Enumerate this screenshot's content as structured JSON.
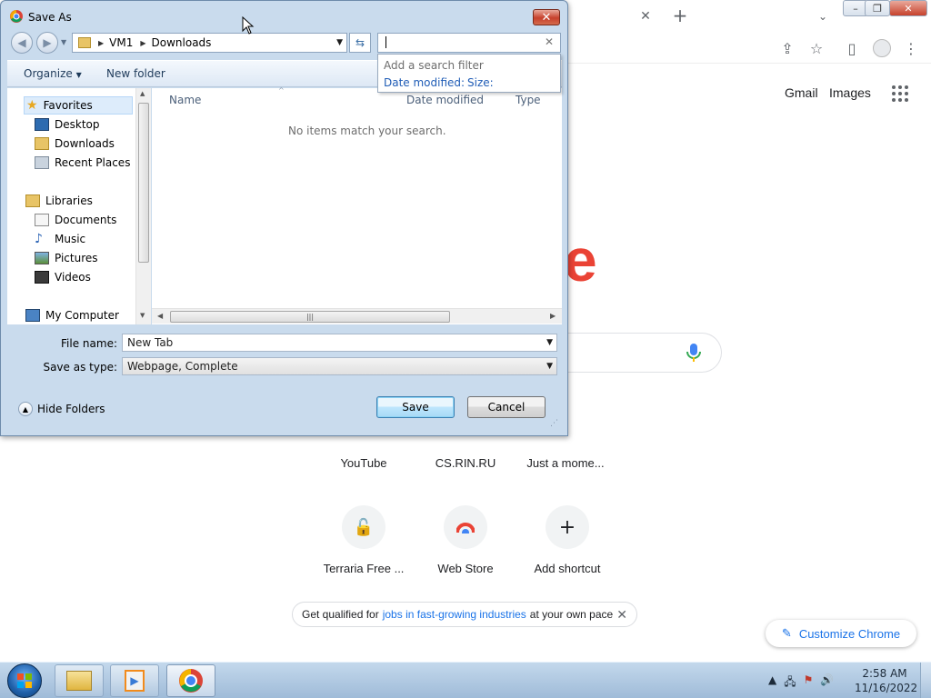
{
  "chrome": {
    "ntp_links": {
      "gmail": "Gmail",
      "images": "Images"
    },
    "logo_fragment": "e",
    "shortcuts": [
      {
        "label": "YouTube"
      },
      {
        "label": "CS.RIN.RU"
      },
      {
        "label": "Just a mome..."
      },
      {
        "label": "Terraria Free ..."
      },
      {
        "label": "Web Store"
      },
      {
        "label": "Add shortcut"
      }
    ],
    "promo": {
      "prefix": "Get qualified for",
      "link": "jobs in fast-growing industries",
      "suffix": "at your own pace"
    },
    "customize_label": "Customize Chrome"
  },
  "dialog": {
    "title": "Save As",
    "breadcrumb": [
      "VM1",
      "Downloads"
    ],
    "search": {
      "value": "",
      "hint": "Add a search filter",
      "filters": [
        "Date modified:",
        "Size:"
      ]
    },
    "commands": {
      "organize": "Organize",
      "new_folder": "New folder"
    },
    "nav": {
      "favorites": "Favorites",
      "desktop": "Desktop",
      "downloads": "Downloads",
      "recent": "Recent Places",
      "libraries": "Libraries",
      "documents": "Documents",
      "music": "Music",
      "pictures": "Pictures",
      "videos": "Videos",
      "computer": "My Computer"
    },
    "columns": {
      "name": "Name",
      "date": "Date modified",
      "type": "Type"
    },
    "empty_message": "No items match your search.",
    "file_name_label": "File name:",
    "file_name_value": "New Tab",
    "save_type_label": "Save as type:",
    "save_type_value": "Webpage, Complete",
    "hide_folders": "Hide Folders",
    "save": "Save",
    "cancel": "Cancel"
  },
  "taskbar": {
    "time": "2:58 AM",
    "date": "11/16/2022"
  }
}
